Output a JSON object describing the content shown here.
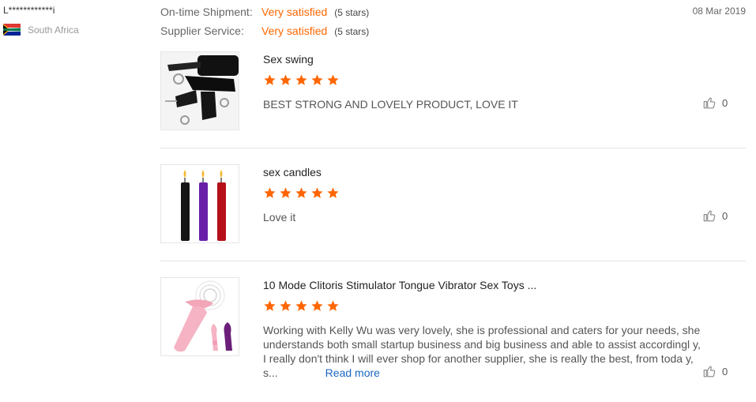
{
  "reviewer": {
    "name": "L************i",
    "country": "South Africa"
  },
  "ratings": [
    {
      "label": "On-time Shipment:",
      "value": "Very satisfied",
      "stars": "(5 stars)"
    },
    {
      "label": "Supplier Service:",
      "value": "Very satisfied",
      "stars": "(5 stars)"
    }
  ],
  "date": "08 Mar 2019",
  "products": [
    {
      "title": "Sex swing",
      "stars": 5,
      "text": "BEST STRONG AND LOVELY PRODUCT, LOVE IT",
      "likes": "0"
    },
    {
      "title": "sex candles",
      "stars": 5,
      "text": "Love it",
      "likes": "0"
    },
    {
      "title": "10 Mode Clitoris Stimulator Tongue Vibrator Sex Toys ...",
      "stars": 5,
      "text": "Working with Kelly Wu was very lovely, she is professional and caters for your needs, she understands both small startup business and big business and able to assist accordingl y, I really don't think I will ever shop for another supplier, she is really the best, from toda y, s...",
      "read_more": "Read more",
      "likes": "0"
    }
  ],
  "colors": {
    "accent": "#ff6600",
    "link": "#1a66c2"
  },
  "icons": {
    "like": "thumbs-up-icon",
    "star": "star-icon",
    "flag": "south-africa-flag-icon"
  }
}
